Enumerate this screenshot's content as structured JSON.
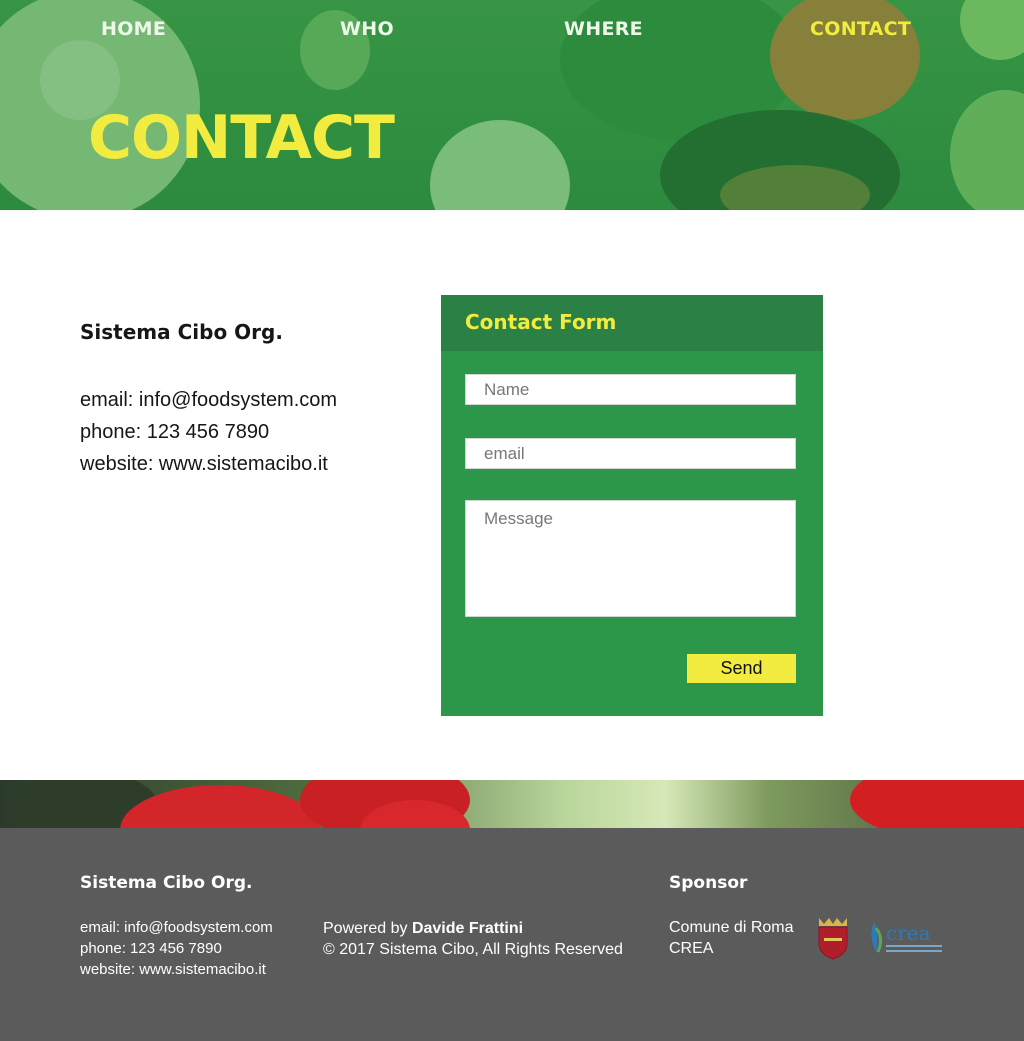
{
  "nav": {
    "items": [
      {
        "label": "HOME"
      },
      {
        "label": "WHO"
      },
      {
        "label": "WHERE"
      },
      {
        "label": "CONTACT",
        "active": true
      }
    ]
  },
  "hero": {
    "title": "CONTACT"
  },
  "contact_info": {
    "org_name": "Sistema Cibo Org.",
    "email": "email: info@foodsystem.com",
    "phone": "phone: 123 456 7890",
    "website": "website: www.sistemacibo.it"
  },
  "form": {
    "title": "Contact Form",
    "name_placeholder": "Name",
    "email_placeholder": "email",
    "message_placeholder": "Message",
    "send_label": "Send"
  },
  "footer": {
    "org_name": "Sistema Cibo Org.",
    "email": "email: info@foodsystem.com",
    "phone": "phone: 123 456 7890",
    "website": "website: www.sistemacibo.it",
    "powered_prefix": "Powered by ",
    "powered_name": "Davide Frattini",
    "copyright": "© 2017 Sistema Cibo, All Rights Reserved",
    "sponsor_title": "Sponsor",
    "sponsors": [
      "Comune di Roma",
      "CREA"
    ],
    "crea_logo_text": "crea"
  },
  "colors": {
    "accent": "#f1ec3f",
    "form_bg": "#2c964b",
    "form_header": "#2a8045",
    "footer_bg": "#5b5b5b",
    "hero_green": "#3f9a4a"
  },
  "icons": {
    "roma_logo": "roma-crest-icon",
    "crea_logo": "crea-logo-icon"
  }
}
